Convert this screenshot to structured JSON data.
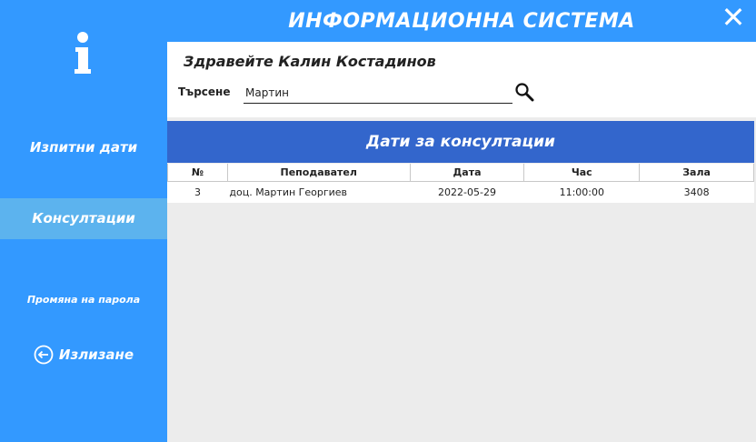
{
  "app": {
    "title": "ИНФОРМАЦИОННА СИСТЕМА",
    "close_glyph": "✕"
  },
  "sidebar": {
    "logo_icon": "info-icon",
    "items": [
      {
        "label": "Изпитни дати",
        "active": false
      },
      {
        "label": "Консултации",
        "active": true
      },
      {
        "label": "Промяна на парола",
        "active": false
      }
    ],
    "logout": {
      "label": "Излизане",
      "icon": "logout-icon"
    }
  },
  "main": {
    "greeting": "Здравейте  Калин Костадинов",
    "search": {
      "label": "Търсене",
      "value": "Мартин",
      "icon": "search-icon"
    },
    "table": {
      "title": "Дати за консултации",
      "columns": [
        "№",
        "Пеподавател",
        "Дата",
        "Час",
        "Зала"
      ],
      "rows": [
        {
          "num": "3",
          "teacher": "доц. Мартин Георгиев",
          "date": "2022-05-29",
          "hour": "11:00:00",
          "room": "3408"
        }
      ]
    }
  },
  "colors": {
    "sidebar": "#3399ff",
    "active_item": "#5cb3ee",
    "table_header": "#3366cc",
    "panel_bg": "#ececec"
  }
}
